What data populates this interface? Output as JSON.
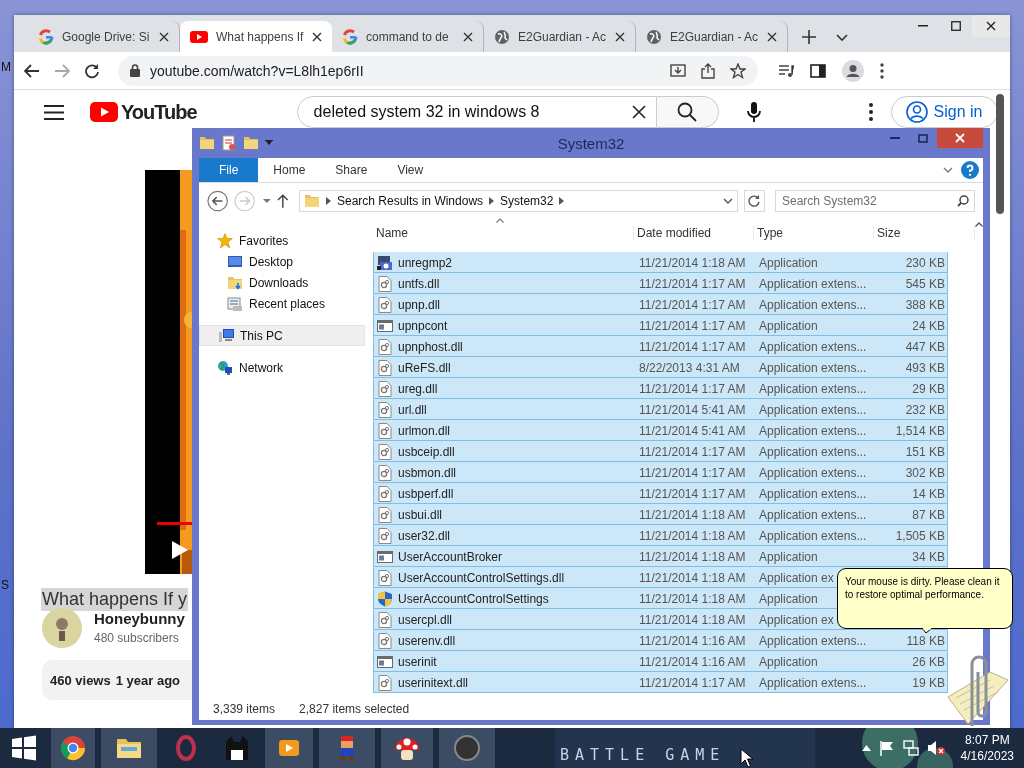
{
  "desktop": {
    "edge_labels": [
      "M",
      "S"
    ]
  },
  "browser": {
    "tabs": [
      {
        "title": "Google Drive: Si",
        "kind": "google",
        "selected": false
      },
      {
        "title": "What happens If",
        "kind": "youtube",
        "selected": true
      },
      {
        "title": "command to de",
        "kind": "google",
        "selected": false
      },
      {
        "title": "E2Guardian - Ac",
        "kind": "globe",
        "selected": false
      },
      {
        "title": "E2Guardian - Ac",
        "kind": "globe",
        "selected": false
      }
    ],
    "address": "youtube.com/watch?v=L8lh1ep6rII",
    "page": {
      "logo": "YouTube",
      "search_query": "deleted system 32 in windows 8",
      "sign_in": "Sign in",
      "video_title": "What happens If y",
      "channel": "Honeybunny",
      "subscribers": "480 subscribers",
      "views": "460 views",
      "age": "1 year ago"
    }
  },
  "explorer": {
    "title": "System32",
    "ribbon_tabs": [
      {
        "label": "File",
        "selected": true
      },
      {
        "label": "Home",
        "selected": false
      },
      {
        "label": "Share",
        "selected": false
      },
      {
        "label": "View",
        "selected": false
      }
    ],
    "breadcrumb": [
      "Search Results in Windows",
      "System32"
    ],
    "search": {
      "placeholder": "Search System32"
    },
    "navigation": [
      {
        "label": "Favorites",
        "kind": "favorites",
        "selected": false,
        "children": [
          {
            "label": "Desktop",
            "kind": "desktop",
            "selected": false
          },
          {
            "label": "Downloads",
            "kind": "downloads",
            "selected": false
          },
          {
            "label": "Recent places",
            "kind": "recent",
            "selected": false
          }
        ]
      },
      {
        "label": "This PC",
        "kind": "pc",
        "selected": true
      },
      {
        "label": "Network",
        "kind": "network",
        "selected": false
      }
    ],
    "columns": [
      "Name",
      "Date modified",
      "Type",
      "Size"
    ],
    "rows": [
      {
        "name": "unregmp2",
        "date": "11/21/2014 1:18 AM",
        "type": "Application",
        "size": "230 KB",
        "kind": "media-app",
        "selected": true
      },
      {
        "name": "untfs.dll",
        "date": "11/21/2014 1:17 AM",
        "type": "Application extens...",
        "size": "545 KB",
        "kind": "dll",
        "selected": true
      },
      {
        "name": "upnp.dll",
        "date": "11/21/2014 1:17 AM",
        "type": "Application extens...",
        "size": "388 KB",
        "kind": "dll",
        "selected": true
      },
      {
        "name": "upnpcont",
        "date": "11/21/2014 1:17 AM",
        "type": "Application",
        "size": "24 KB",
        "kind": "app",
        "selected": true
      },
      {
        "name": "upnphost.dll",
        "date": "11/21/2014 1:17 AM",
        "type": "Application extens...",
        "size": "447 KB",
        "kind": "dll",
        "selected": true
      },
      {
        "name": "uReFS.dll",
        "date": "8/22/2013 4:31 AM",
        "type": "Application extens...",
        "size": "493 KB",
        "kind": "dll",
        "selected": true
      },
      {
        "name": "ureg.dll",
        "date": "11/21/2014 1:17 AM",
        "type": "Application extens...",
        "size": "29 KB",
        "kind": "dll",
        "selected": true
      },
      {
        "name": "url.dll",
        "date": "11/21/2014 5:41 AM",
        "type": "Application extens...",
        "size": "232 KB",
        "kind": "dll",
        "selected": true
      },
      {
        "name": "urlmon.dll",
        "date": "11/21/2014 5:41 AM",
        "type": "Application extens...",
        "size": "1,514 KB",
        "kind": "dll",
        "selected": true
      },
      {
        "name": "usbceip.dll",
        "date": "11/21/2014 1:17 AM",
        "type": "Application extens...",
        "size": "151 KB",
        "kind": "dll",
        "selected": true
      },
      {
        "name": "usbmon.dll",
        "date": "11/21/2014 1:17 AM",
        "type": "Application extens...",
        "size": "302 KB",
        "kind": "dll",
        "selected": true
      },
      {
        "name": "usbperf.dll",
        "date": "11/21/2014 1:17 AM",
        "type": "Application extens...",
        "size": "14 KB",
        "kind": "dll",
        "selected": true
      },
      {
        "name": "usbui.dll",
        "date": "11/21/2014 1:18 AM",
        "type": "Application extens...",
        "size": "87 KB",
        "kind": "dll",
        "selected": true
      },
      {
        "name": "user32.dll",
        "date": "11/21/2014 1:18 AM",
        "type": "Application extens...",
        "size": "1,505 KB",
        "kind": "dll",
        "selected": true
      },
      {
        "name": "UserAccountBroker",
        "date": "11/21/2014 1:18 AM",
        "type": "Application",
        "size": "34 KB",
        "kind": "app",
        "selected": true
      },
      {
        "name": "UserAccountControlSettings.dll",
        "date": "11/21/2014 1:18 AM",
        "type": "Application ex",
        "kind": "dll",
        "selected": true
      },
      {
        "name": "UserAccountControlSettings",
        "date": "11/21/2014 1:18 AM",
        "type": "Application",
        "kind": "shield-app",
        "selected": true
      },
      {
        "name": "usercpl.dll",
        "date": "11/21/2014 1:18 AM",
        "type": "Application ex",
        "kind": "dll",
        "selected": true
      },
      {
        "name": "userenv.dll",
        "date": "11/21/2014 1:16 AM",
        "type": "Application extens...",
        "size": "118 KB",
        "kind": "dll",
        "selected": true
      },
      {
        "name": "userinit",
        "date": "11/21/2014 1:16 AM",
        "type": "Application",
        "size": "26 KB",
        "kind": "app",
        "selected": true
      },
      {
        "name": "userinitext.dll",
        "date": "11/21/2014 1:17 AM",
        "type": "Application extens...",
        "size": "19 KB",
        "kind": "dll",
        "selected": true
      }
    ],
    "status": {
      "items": "3,339 items",
      "selected": "2,827 items selected"
    }
  },
  "assistant": {
    "message": "Your mouse is dirty. Please clean it to restore optimal performance."
  },
  "taskbar": {
    "banner_text": "BATTLE GAME",
    "time": "8:07 PM",
    "date": "4/16/2023"
  }
}
